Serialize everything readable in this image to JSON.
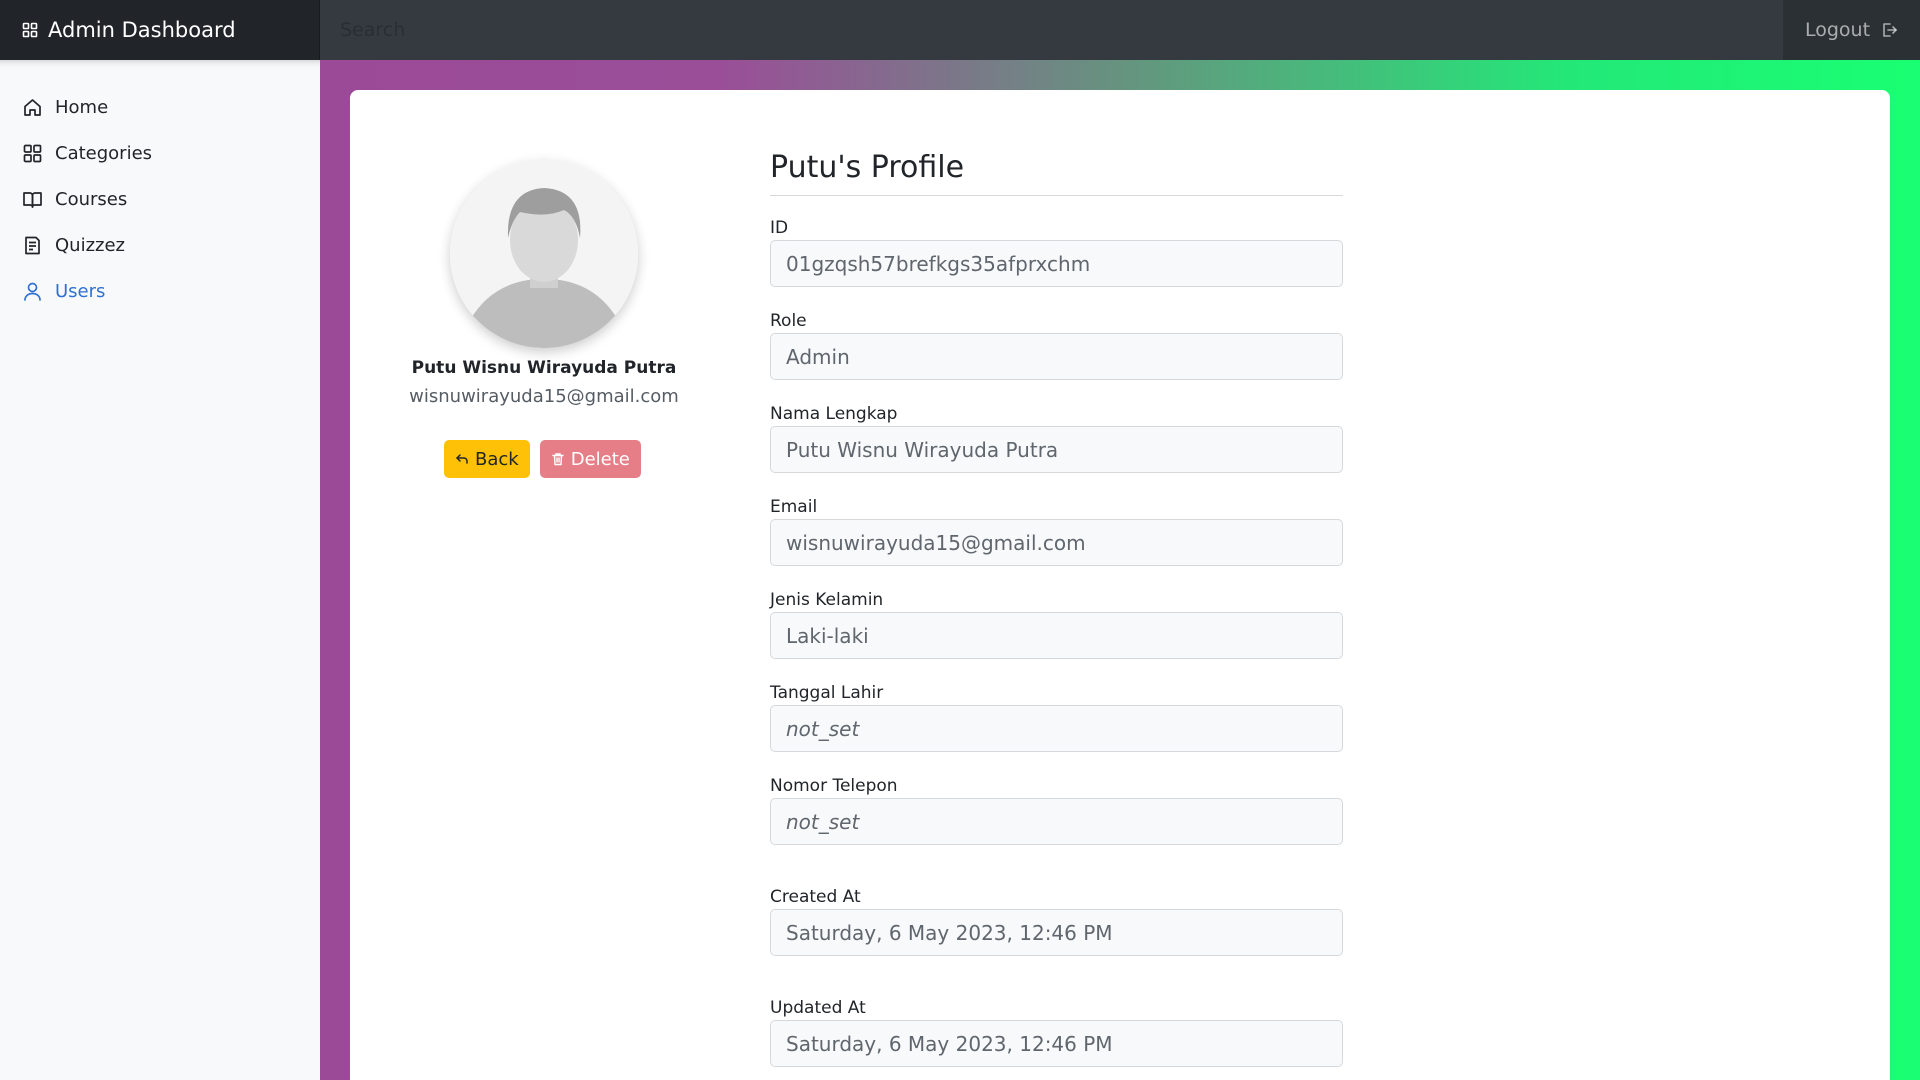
{
  "brand": {
    "title": "Admin Dashboard",
    "icon": "grid-icon"
  },
  "search": {
    "placeholder": "Search"
  },
  "logout": {
    "label": "Logout",
    "icon": "logout-icon"
  },
  "sidebar": {
    "items": [
      {
        "label": "Home",
        "icon": "home-icon",
        "active": false
      },
      {
        "label": "Categories",
        "icon": "grid-icon",
        "active": false
      },
      {
        "label": "Courses",
        "icon": "book-icon",
        "active": false
      },
      {
        "label": "Quizzez",
        "icon": "quiz-icon",
        "active": false
      },
      {
        "label": "Users",
        "icon": "user-icon",
        "active": true
      }
    ]
  },
  "profile": {
    "name": "Putu Wisnu Wirayuda Putra",
    "email": "wisnuwirayuda15@gmail.com",
    "back_label": "Back",
    "delete_label": "Delete"
  },
  "form": {
    "title": "Putu's Profile",
    "fields": [
      {
        "label": "ID",
        "value": "01gzqsh57brefkgs35afprxchm"
      },
      {
        "label": "Role",
        "value": "Admin"
      },
      {
        "label": "Nama Lengkap",
        "value": "Putu Wisnu Wirayuda Putra"
      },
      {
        "label": "Email",
        "value": "wisnuwirayuda15@gmail.com"
      },
      {
        "label": "Jenis Kelamin",
        "value": "Laki-laki"
      },
      {
        "label": "Tanggal Lahir",
        "value": "not_set"
      },
      {
        "label": "Nomor Telepon",
        "value": "not_set"
      },
      {
        "label": "Created At",
        "value": "Saturday, 6 May 2023, 12:46 PM"
      },
      {
        "label": "Updated At",
        "value": "Saturday, 6 May 2023, 12:46 PM"
      }
    ]
  },
  "colors": {
    "navbar": "#343a40",
    "brand_bg": "#212529",
    "active_link": "#2f6fd6",
    "back_button": "#ffc107",
    "delete_button": "#e57e87",
    "gradient_left": "#9b4a97",
    "gradient_right": "#19ff72"
  }
}
